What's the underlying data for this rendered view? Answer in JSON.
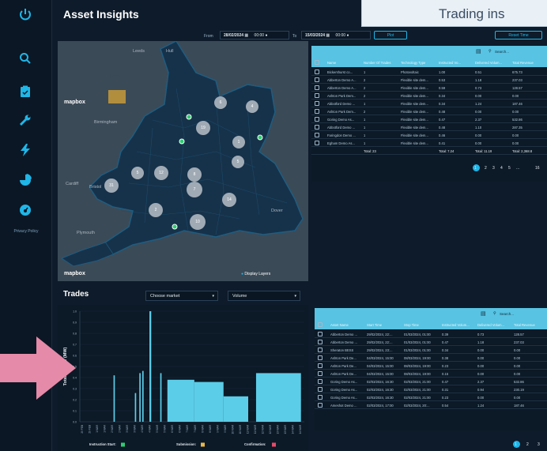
{
  "app_title": "Asset Insights",
  "callout": "Trading ins",
  "sidebar": {
    "privacy": "Privacy Policy"
  },
  "filters": {
    "from_label": "From",
    "from_date": "28/02/2024",
    "from_time": "00:00",
    "to_label": "To",
    "to_date": "15/03/2024",
    "to_time": "00:00",
    "plot": "Plot",
    "reset": "Reset Time"
  },
  "map": {
    "attribution_top": "mapbox",
    "attribution_bottom": "mapbox",
    "display_layers": "Display Layers",
    "places": [
      "Leeds",
      "Hull",
      "Birmingham",
      "Cardiff",
      "Bristol",
      "London",
      "Dover",
      "Plymouth"
    ],
    "clusters": [
      "6",
      "4",
      "19",
      "1",
      "5",
      "5",
      "12",
      "8",
      "31",
      "7",
      "14",
      "2",
      "10"
    ]
  },
  "assets_table": {
    "search": "Search...",
    "headers": [
      "Name",
      "Number Of Trades",
      "Technology Type",
      "Instructed Vo...",
      "Delivered Volum...",
      "Total Revenue"
    ],
    "rows": [
      [
        "Bickershurst co...",
        "1",
        "Photovoltaic",
        "1.00",
        "0.51",
        "675.73"
      ],
      [
        "Abberton Demo A...",
        "2",
        "Flexible site dem...",
        "0.53",
        "1.18",
        "237.03"
      ],
      [
        "Abberton Demo A...",
        "2",
        "Flexible site dem...",
        "0.59",
        "0.73",
        "128.57"
      ],
      [
        "Ashton Park Dem...",
        "2",
        "Flexible site dem...",
        "0.34",
        "0.00",
        "0.00"
      ],
      [
        "Abbotford Demo ...",
        "1",
        "Flexible site dem...",
        "0.34",
        "1.24",
        "187.46"
      ],
      [
        "Ashton Park Dem...",
        "2",
        "Flexible site dem...",
        "0.48",
        "0.00",
        "0.00"
      ],
      [
        "Goring Demo As...",
        "1",
        "Flexible site dem...",
        "0.47",
        "2.37",
        "532.86"
      ],
      [
        "Abbotford Demo ...",
        "1",
        "Flexible site dem...",
        "0.48",
        "1.10",
        "287.35"
      ],
      [
        "Faringdon Demo ...",
        "1",
        "Flexible site dem...",
        "0.46",
        "0.00",
        "0.00"
      ],
      [
        "Egham Demo As...",
        "1",
        "Flexible site dem...",
        "0.41",
        "0.00",
        "0.00"
      ]
    ],
    "totals": [
      "Total: 23",
      "Total: 7.24",
      "Total: 11.19",
      "Total: 2,368.8"
    ],
    "pages": [
      "1",
      "2",
      "3",
      "4",
      "5",
      "...",
      "16"
    ]
  },
  "trades": {
    "title": "Trades",
    "market_select": "Choose market",
    "metric_select": "Volume"
  },
  "chart_data": {
    "type": "bar",
    "ylabel": "Total Volume (MW)",
    "yticks": [
      "1.0",
      "0.9",
      "0.8",
      "0.7",
      "0.6",
      "0.5",
      "0.4",
      "0.3",
      "0.2",
      "0.1",
      "0.0"
    ],
    "ylim": [
      0,
      1.0
    ],
    "x_tick_labels": [
      "29 FEB",
      "29 FEB",
      "1 MAR",
      "1 MAR",
      "2 MAR",
      "2 MAR",
      "3 MAR",
      "3 MAR",
      "4 MAR",
      "4 MAR",
      "5 MAR",
      "5 MAR",
      "6 MAR",
      "6 MAR",
      "7 MAR",
      "7 MAR",
      "8 MAR",
      "8 MAR",
      "9 MAR",
      "9 MAR",
      "10 MAR",
      "10 MAR",
      "11 MAR",
      "11 MAR",
      "12 MAR",
      "12 MAR",
      "13 MAR",
      "13 MAR",
      "14 MAR",
      "14 MAR"
    ],
    "bars": [
      {
        "x": 0.15,
        "w": 0.006,
        "value": 0.42
      },
      {
        "x": 0.245,
        "w": 0.006,
        "value": 0.26
      },
      {
        "x": 0.265,
        "w": 0.006,
        "value": 0.44
      },
      {
        "x": 0.278,
        "w": 0.006,
        "value": 0.46
      },
      {
        "x": 0.31,
        "w": 0.008,
        "value": 1.0
      },
      {
        "x": 0.358,
        "w": 0.006,
        "value": 0.44
      },
      {
        "x": 0.39,
        "w": 0.12,
        "value": 0.38
      },
      {
        "x": 0.51,
        "w": 0.13,
        "value": 0.36
      },
      {
        "x": 0.64,
        "w": 0.11,
        "value": 0.23
      },
      {
        "x": 0.785,
        "w": 0.2,
        "value": 0.44
      }
    ],
    "legend": [
      {
        "label": "Instruction Start:",
        "color": "#2ecc71"
      },
      {
        "label": "Submission:",
        "color": "#e8b84a"
      },
      {
        "label": "Confirmation:",
        "color": "#e84a6a"
      }
    ]
  },
  "trades_table": {
    "search": "Search...",
    "headers": [
      "Asset Name",
      "Start Time",
      "Stop Time",
      "Instructed Volum...",
      "Delivered Volum...",
      "Total Revenue"
    ],
    "rows": [
      [
        "Abberton Demo ...",
        "29/02/2024, 22:...",
        "01/03/2024, 01:00",
        "0.39",
        "0.73",
        "128.57"
      ],
      [
        "Abberton Demo ...",
        "29/02/2024, 22:...",
        "01/03/2024, 01:00",
        "0.47",
        "1.18",
        "237.03"
      ],
      [
        "Sheraton BESS",
        "29/02/2024, 23:...",
        "01/03/2024, 01:00",
        "0.34",
        "0.00",
        "0.00"
      ],
      [
        "Ashton Park De...",
        "04/03/2024, 15:00",
        "08/03/2024, 19:00",
        "0.38",
        "0.00",
        "0.00"
      ],
      [
        "Ashton Park De...",
        "04/03/2024, 15:00",
        "08/03/2024, 19:00",
        "0.23",
        "0.00",
        "0.00"
      ],
      [
        "Ashton Park De...",
        "04/03/2024, 15:00",
        "08/03/2024, 19:00",
        "0.15",
        "0.00",
        "0.00"
      ],
      [
        "Goring Demo As...",
        "02/03/2024, 16:30",
        "02/03/2024, 21:00",
        "0.47",
        "2.37",
        "532.86"
      ],
      [
        "Goring Demo As...",
        "02/03/2024, 16:30",
        "02/03/2024, 21:00",
        "0.31",
        "0.94",
        "230.19"
      ],
      [
        "Goring Demo As...",
        "02/03/2024, 16:30",
        "02/03/2024, 21:00",
        "0.23",
        "0.00",
        "0.00"
      ],
      [
        "Ameshot Demo ...",
        "02/03/2024, 17:00",
        "02/03/2024, 20:...",
        "0.54",
        "1.24",
        "187.46"
      ]
    ],
    "pages": [
      "1",
      "2",
      "3"
    ]
  },
  "colors": {
    "accent": "#1fb6e8",
    "bar": "#5ccde8",
    "header": "#58c3e2",
    "arrow": "#e58aa8"
  }
}
